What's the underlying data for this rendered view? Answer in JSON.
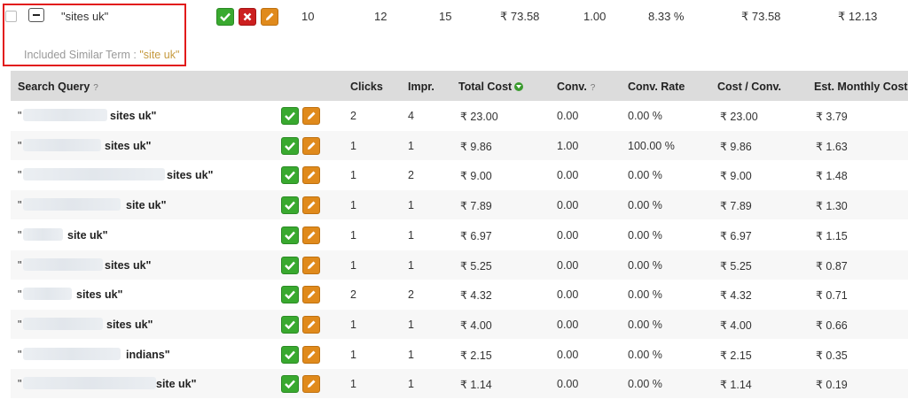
{
  "top": {
    "keyword": "\"sites uk\"",
    "values": [
      "10",
      "12",
      "15",
      "₹ 73.58",
      "1.00",
      "8.33 %",
      "₹ 73.58",
      "₹ 12.13"
    ],
    "similar_label": "Included Similar Term : ",
    "similar_term": "\"site uk\""
  },
  "table": {
    "headers": {
      "query": "Search Query",
      "clicks": "Clicks",
      "impr": "Impr.",
      "total_cost": "Total Cost",
      "conv": "Conv.",
      "conv_rate": "Conv. Rate",
      "cost_conv": "Cost / Conv.",
      "est_monthly": "Est. Monthly Cost"
    },
    "help_glyph": "?",
    "rows": [
      {
        "open": "\"",
        "query": "sites uk\"",
        "clicks": "2",
        "impr": "4",
        "cost": "₹ 23.00",
        "conv": "0.00",
        "rate": "0.00 %",
        "cpc": "₹ 23.00",
        "est": "₹ 3.79"
      },
      {
        "open": "\"",
        "query": "sites uk\"",
        "clicks": "1",
        "impr": "1",
        "cost": "₹ 9.86",
        "conv": "1.00",
        "rate": "100.00 %",
        "cpc": "₹ 9.86",
        "est": "₹ 1.63"
      },
      {
        "open": "\"",
        "query": "sites uk\"",
        "clicks": "1",
        "impr": "2",
        "cost": "₹ 9.00",
        "conv": "0.00",
        "rate": "0.00 %",
        "cpc": "₹ 9.00",
        "est": "₹ 1.48"
      },
      {
        "open": "\"",
        "query": "site uk\"",
        "clicks": "1",
        "impr": "1",
        "cost": "₹ 7.89",
        "conv": "0.00",
        "rate": "0.00 %",
        "cpc": "₹ 7.89",
        "est": "₹ 1.30"
      },
      {
        "open": "\"",
        "query": "site uk\"",
        "clicks": "1",
        "impr": "1",
        "cost": "₹ 6.97",
        "conv": "0.00",
        "rate": "0.00 %",
        "cpc": "₹ 6.97",
        "est": "₹ 1.15"
      },
      {
        "open": "\"",
        "query": "sites uk\"",
        "clicks": "1",
        "impr": "1",
        "cost": "₹ 5.25",
        "conv": "0.00",
        "rate": "0.00 %",
        "cpc": "₹ 5.25",
        "est": "₹ 0.87"
      },
      {
        "open": "\"",
        "query": "sites uk\"",
        "clicks": "2",
        "impr": "2",
        "cost": "₹ 4.32",
        "conv": "0.00",
        "rate": "0.00 %",
        "cpc": "₹ 4.32",
        "est": "₹ 0.71"
      },
      {
        "open": "\"",
        "query": "sites uk\"",
        "clicks": "1",
        "impr": "1",
        "cost": "₹ 4.00",
        "conv": "0.00",
        "rate": "0.00 %",
        "cpc": "₹ 4.00",
        "est": "₹ 0.66"
      },
      {
        "open": "\"",
        "query": "indians\"",
        "clicks": "1",
        "impr": "1",
        "cost": "₹ 2.15",
        "conv": "0.00",
        "rate": "0.00 %",
        "cpc": "₹ 2.15",
        "est": "₹ 0.35"
      },
      {
        "open": "\"",
        "query": "site uk\"",
        "clicks": "1",
        "impr": "1",
        "cost": "₹ 1.14",
        "conv": "0.00",
        "rate": "0.00 %",
        "cpc": "₹ 1.14",
        "est": "₹ 0.19"
      }
    ]
  },
  "colors": {
    "approve": "#39a92f",
    "reject": "#cc1f1f",
    "edit": "#e08a1c",
    "highlight_box": "#e21b1b",
    "header_bg": "#dcdcdc"
  },
  "icons": [
    "check-icon",
    "x-icon",
    "pencil-icon",
    "minus-icon",
    "sort-down-icon"
  ]
}
